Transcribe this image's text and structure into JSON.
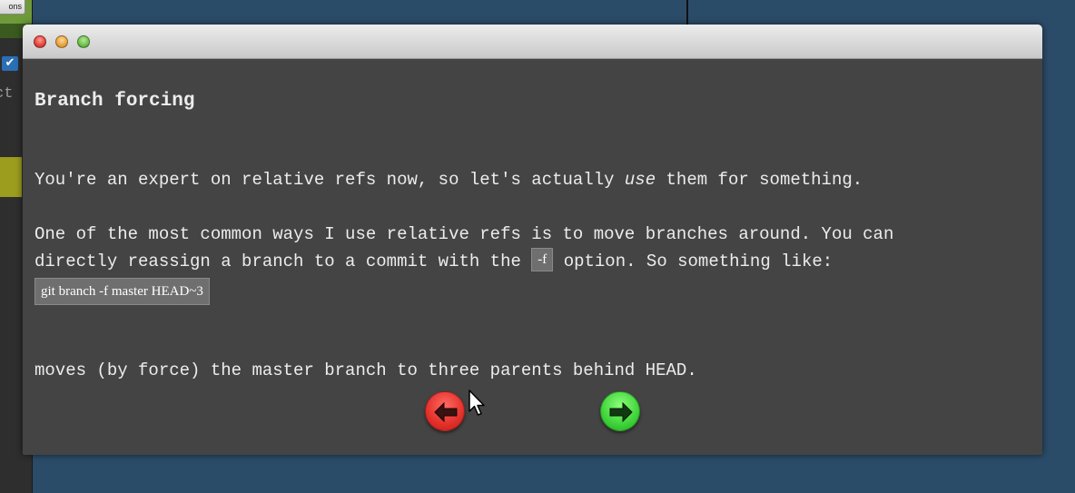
{
  "background_app": {
    "options_button": "ons",
    "checkbox_icon": "check-icon",
    "partial_text": "ct"
  },
  "dialog": {
    "title_lights": [
      "close",
      "minimize",
      "maximize"
    ],
    "heading": "Branch forcing",
    "para1_before": "You're an expert on relative refs now, so let's actually ",
    "para1_em": "use",
    "para1_after": " them for something.",
    "para2_line1": "One of the most common ways I use relative refs is to move branches around. You can",
    "para2_line2_before": "directly reassign a branch to a commit with the ",
    "para2_code": "-f",
    "para2_line2_after": " option. So something like:",
    "code_block": "git branch -f master HEAD~3",
    "para3": "moves (by force) the master branch to three parents behind HEAD.",
    "nav": {
      "back_icon": "arrow-left-icon",
      "next_icon": "arrow-right-icon"
    }
  },
  "colors": {
    "page_bg": "#2b4c69",
    "dialog_bg": "#444444",
    "back_button": "#e4302a",
    "next_button": "#3fd43a"
  }
}
